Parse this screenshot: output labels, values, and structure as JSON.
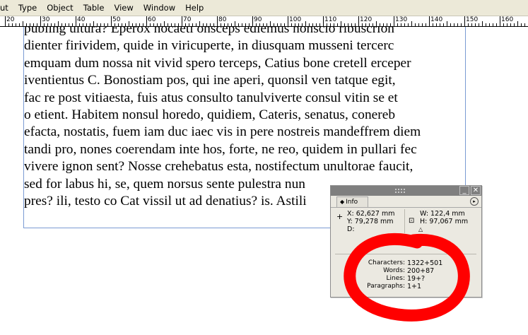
{
  "menu": [
    "ut",
    "Type",
    "Object",
    "Table",
    "View",
    "Window",
    "Help"
  ],
  "ruler": {
    "labels": [
      "20",
      "30",
      "40",
      "50",
      "60",
      "70",
      "80",
      "90",
      "100",
      "110",
      "120",
      "130",
      "140",
      "150",
      "160"
    ]
  },
  "story": {
    "lines": [
      "publing ultura? Eperox nocaeti onsceps ediemus nonscio ribuscrion",
      "dienter firividem, quide in viricuperte, in diusquam musseni tercerc",
      "emquam dum nossa nit vivid spero terceps, Catius bone cretell erceper",
      "iventientus C. Bonostiam pos, qui ine aperi, quonsil ven tatque egit,",
      "fac re post vitiaesta, fuis atus consulto tanulviverte consul vitin se et",
      "o etient. Habitem nonsul horedo, quidiem, Cateris, senatus, conereb",
      "efacta, nostatis, fuem iam duc iaec vis in pere nostreis mandeffrem diem",
      "tandi pro, nones coerendam inte hos, forte, ne reo, quidem in pullari fec",
      "vivere ignon sent? Nosse crehebatus esta, nostifectum unultorae faucit,",
      "sed for labus hi, se, quem norsus sente pulestra nun",
      "pres? ili, testo co Cat vissil ut ad denatius? is. Astili"
    ]
  },
  "info_panel": {
    "tab": "Info",
    "x": "X: 62,627 mm",
    "y": "Y: 79,278 mm",
    "d": "D:",
    "w": "W: 122,4 mm",
    "h": "H: 97,067 mm",
    "stats": [
      {
        "label": "Characters:",
        "value": "1322+501"
      },
      {
        "label": "Words:",
        "value": "200+87"
      },
      {
        "label": "Lines:",
        "value": "19+?"
      },
      {
        "label": "Paragraphs:",
        "value": "1+1"
      }
    ]
  },
  "colors": {
    "annotation": "#ff0000",
    "frame_border": "#7a9bd3",
    "menubar": "#ece9d8",
    "panel_titlebar": "#7f7f7f"
  },
  "icons": {
    "tab": "diamond-arrows-icon",
    "panel_menu": "triangle-menu-icon",
    "crosshair": "crosshair-icon",
    "frame_size": "frame-size-icon",
    "angle": "angle-icon",
    "minimize": "minimize-icon",
    "close": "close-icon",
    "grip": "grip-icon"
  }
}
